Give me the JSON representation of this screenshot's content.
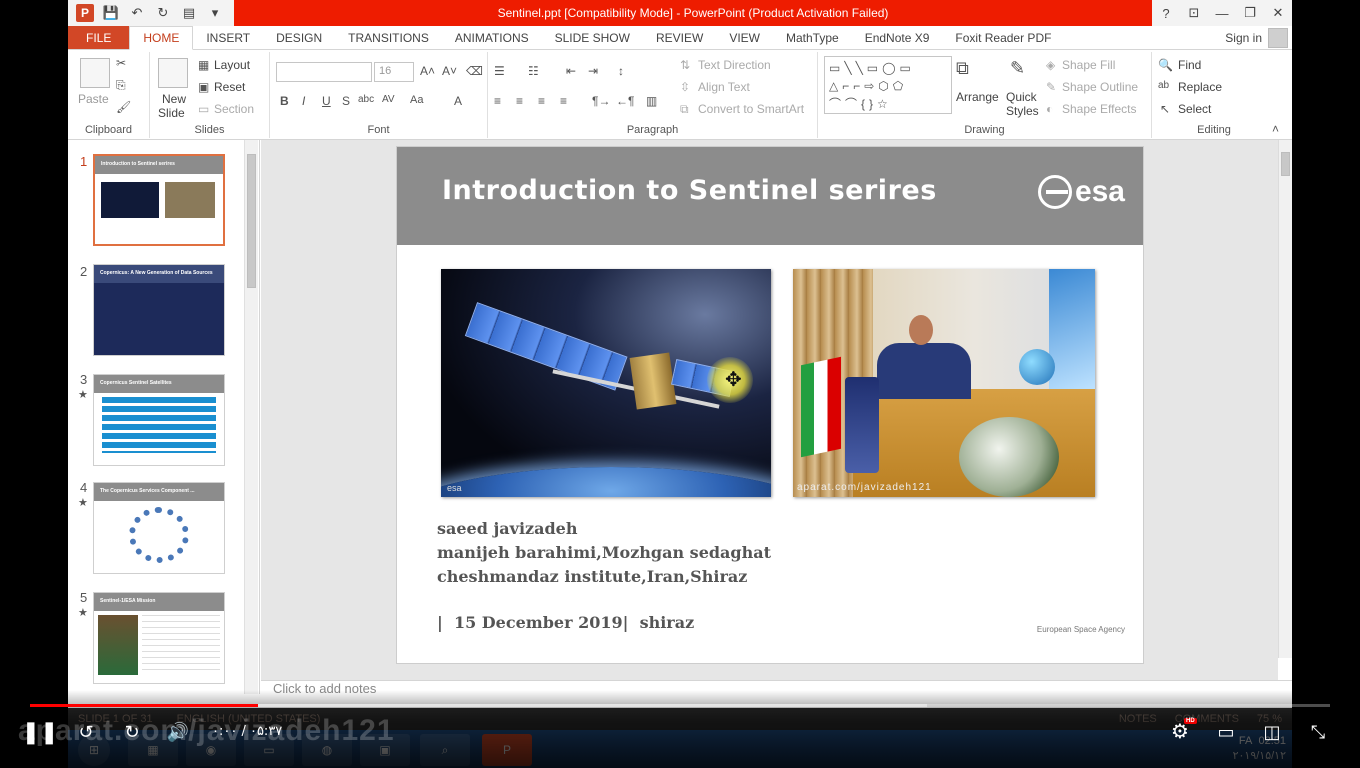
{
  "window": {
    "title": "Sentinel.ppt [Compatibility Mode] - PowerPoint (Product Activation Failed)",
    "controls": {
      "help": "?",
      "ribbon_opts": "⊡",
      "minimize": "—",
      "restore": "❐",
      "close": "✕"
    }
  },
  "tabs": [
    "FILE",
    "HOME",
    "INSERT",
    "DESIGN",
    "TRANSITIONS",
    "ANIMATIONS",
    "SLIDE SHOW",
    "REVIEW",
    "VIEW",
    "MathType",
    "EndNote X9",
    "Foxit Reader PDF"
  ],
  "active_tab": "HOME",
  "sign_in": "Sign in",
  "ribbon": {
    "clipboard": {
      "label": "Clipboard",
      "paste": "Paste"
    },
    "slides": {
      "label": "Slides",
      "new_slide": "New",
      "new_slide2": "Slide",
      "layout": "Layout",
      "reset": "Reset",
      "section": "Section"
    },
    "font": {
      "label": "Font",
      "size": "16"
    },
    "paragraph": {
      "label": "Paragraph",
      "text_direction": "Text Direction",
      "align_text": "Align Text",
      "convert_smartart": "Convert to SmartArt"
    },
    "drawing": {
      "label": "Drawing",
      "arrange": "Arrange",
      "quick": "Quick",
      "styles": "Styles",
      "shape_fill": "Shape Fill",
      "shape_outline": "Shape Outline",
      "shape_effects": "Shape Effects"
    },
    "editing": {
      "label": "Editing",
      "find": "Find",
      "replace": "Replace",
      "select": "Select"
    }
  },
  "thumbnails": [
    {
      "num": "1",
      "title": "Introduction to Sentinel serires",
      "star": "",
      "selected": true
    },
    {
      "num": "2",
      "title": "Copernicus: A New Generation of Data Sources",
      "star": "",
      "selected": false
    },
    {
      "num": "3",
      "title": "Copernicus Sentinel Satellites",
      "star": "★",
      "selected": false
    },
    {
      "num": "4",
      "title": "The Copernicus Services Component ...",
      "star": "★",
      "selected": false
    },
    {
      "num": "5",
      "title": "Sentinel-1/ESA Mission",
      "star": "★",
      "selected": false
    }
  ],
  "slide": {
    "title": "Introduction to Sentinel serires",
    "logo_text": "esa",
    "photo1_caption": "esa",
    "photo2_watermark": "aparat.com/javizadeh121",
    "authors": [
      "saeed javizadeh",
      "manijeh barahimi,Mozhgan sedaghat",
      "cheshmandaz institute,Iran,Shiraz"
    ],
    "dateline": "|  15 December 2019|  shiraz",
    "footer": "European Space Agency"
  },
  "notes_placeholder": "Click to add notes",
  "status": {
    "slide_of": "SLIDE 1 OF 31",
    "language": "ENGLISH (UNITED STATES)",
    "notes": "NOTES",
    "comments": "COMMENTS",
    "zoom": "75 %"
  },
  "taskbar": {
    "lang": "FA",
    "time": "02:51",
    "date": "۲۰۱۹/۱۵/۱۲"
  },
  "player": {
    "time": "۰:۰۰ / ۰۵:۳۷",
    "watermark": "aparat.com/javizadeh121",
    "progress": 0.175,
    "buffered": 0.69
  }
}
